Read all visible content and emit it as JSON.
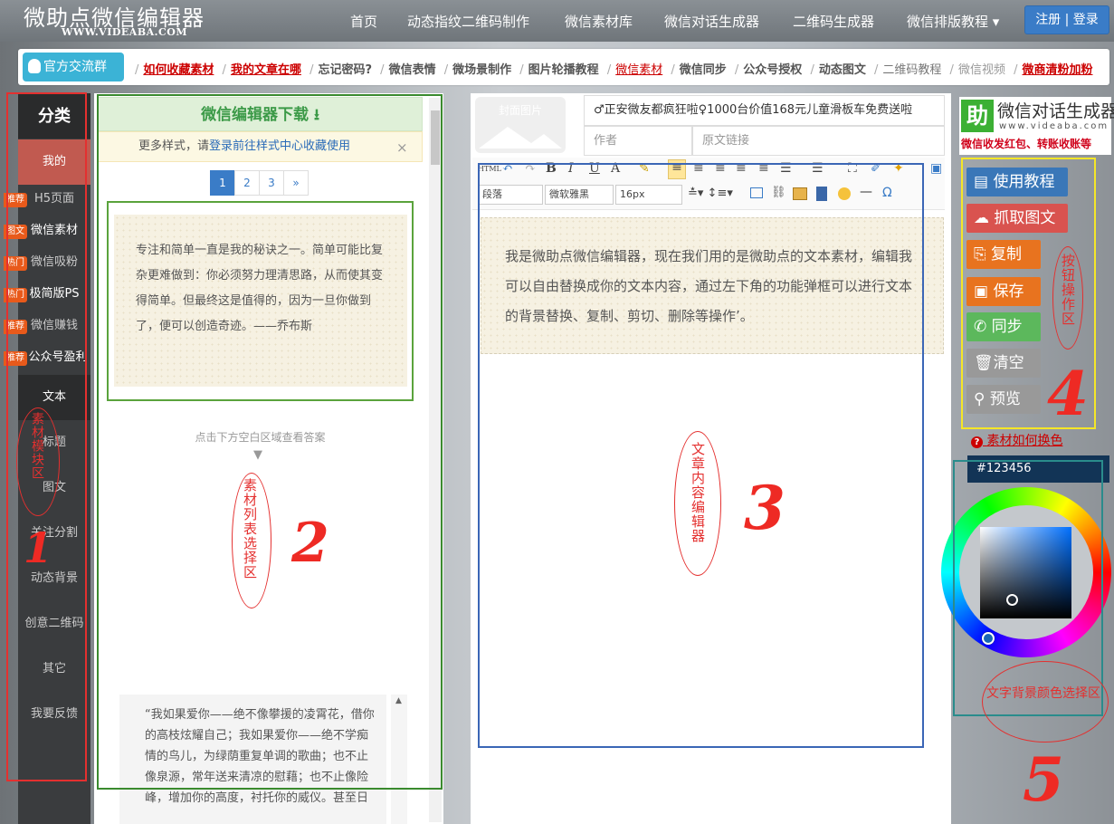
{
  "brand": {
    "title": "微助点微信编辑器",
    "subtitle": "WWW.VIDEABA.COM"
  },
  "nav": {
    "items": [
      "首页",
      "动态指纹二维码制作",
      "微信素材库",
      "微信对话生成器",
      "二维码生成器",
      "微信排版教程 ▾"
    ],
    "login": "注册 | 登录"
  },
  "linkbar": {
    "group": "官方交流群",
    "links": [
      {
        "text": "如何收藏素材",
        "style": "red"
      },
      {
        "text": "我的文章在哪",
        "style": "red"
      },
      {
        "text": "忘记密码?",
        "style": "bold"
      },
      {
        "text": "微信表情",
        "style": "normal"
      },
      {
        "text": "微场景制作",
        "style": "normal"
      },
      {
        "text": "图片轮播教程",
        "style": "normal"
      },
      {
        "text": "微信素材",
        "style": "red"
      },
      {
        "text": "微信同步",
        "style": "normal"
      },
      {
        "text": "公众号授权",
        "style": "normal"
      },
      {
        "text": "动态图文",
        "style": "normal"
      },
      {
        "text": "二维码教程",
        "style": "normal"
      },
      {
        "text": "微信视频",
        "style": "normal"
      },
      {
        "text": "微商清粉加粉",
        "style": "red"
      }
    ]
  },
  "sidebar": {
    "heading": "分类",
    "items": [
      {
        "label": "我的",
        "badge": ""
      },
      {
        "label": "H5页面",
        "badge": "推荐"
      },
      {
        "label": "微信素材",
        "badge": "图文"
      },
      {
        "label": "微信吸粉",
        "badge": "热门"
      },
      {
        "label": "极简版PS",
        "badge": "热门"
      },
      {
        "label": "微信赚钱",
        "badge": "推荐"
      },
      {
        "label": "公众号盈利",
        "badge": "推荐"
      },
      {
        "label": "文本",
        "badge": ""
      },
      {
        "label": "标题",
        "badge": ""
      },
      {
        "label": "图文",
        "badge": ""
      },
      {
        "label": "关注分割",
        "badge": ""
      },
      {
        "label": "动态背景",
        "badge": ""
      },
      {
        "label": "创意二维码",
        "badge": ""
      },
      {
        "label": "其它",
        "badge": ""
      },
      {
        "label": "我要反馈",
        "badge": ""
      }
    ]
  },
  "material_panel": {
    "download_title": "微信编辑器下载",
    "notice_prefix": "更多样式，请",
    "notice_link": "登录前往样式中心收藏使用",
    "close": "×",
    "pages": [
      "1",
      "2",
      "3",
      "»"
    ],
    "card1_text": "专注和简单一直是我的秘诀之一。简单可能比复杂更难做到：你必须努力理清思路，从而使其变得简单。但最终这是值得的，因为一旦你做到了，便可以创造奇迹。——乔布斯",
    "hint": "点击下方空白区域查看答案",
    "hint_arrow": "▼",
    "card2_text": "“我如果爱你——绝不像攀援的凌霄花，借你的高枝炫耀自己；我如果爱你——绝不学痴情的鸟儿，为绿荫重复单调的歌曲；也不止像泉源，常年送来清凉的慰藉；也不止像险峰，增加你的高度，衬托你的威仪。甚至日"
  },
  "editor": {
    "cover": "封面图片",
    "title_value": "♂正安微友都疯狂啦♀1000台价值168元儿童滑板车免费送啦",
    "author_placeholder": "作者",
    "link_placeholder": "原文链接",
    "toolbar_row1": [
      "HTML",
      "↶",
      "↷",
      "B",
      "I",
      "U",
      "A",
      "✎",
      "≡",
      "≡",
      "≡",
      "≡",
      "≡",
      "☰",
      "☰",
      "⛶",
      "✐",
      "✦",
      "▣"
    ],
    "paragraph": "段落",
    "font": "微软雅黑",
    "size": "16px",
    "content": "我是微助点微信编辑器，现在我们用的是微助点的文本素材，编辑我可以自由替换成你的文本内容，通过左下角的功能弹框可以进行文本的背景替换、复制、剪切、删除等操作’。"
  },
  "right": {
    "ad_logo": "助",
    "ad_title": "微信对话生成器",
    "ad_url": "www.videaba.com",
    "ad_sub": "微信收发红包、转账收账等",
    "buttons": [
      {
        "label": "使用教程",
        "icon": "book-icon",
        "color": "#3a77b8"
      },
      {
        "label": "抓取图文",
        "icon": "download-cloud-icon",
        "color": "#d9534f"
      },
      {
        "label": "复制",
        "icon": "copy-icon",
        "color": "#e8731f"
      },
      {
        "label": "保存",
        "icon": "save-icon",
        "color": "#e8731f"
      },
      {
        "label": "同步",
        "icon": "wechat-icon",
        "color": "#5cb85c"
      },
      {
        "label": "清空",
        "icon": "trash-icon",
        "color": "#999999"
      },
      {
        "label": "预览",
        "icon": "search-icon",
        "color": "#999999"
      }
    ],
    "howto": "素材如何换色",
    "hex": "#123456"
  },
  "annotations": {
    "a1": "素材模块区",
    "a2": "素材列表选择区",
    "a3": "文章内容编辑器",
    "a4": "按钮操作区",
    "a5": "文字背景颜色选择区",
    "n1": "1",
    "n2": "2",
    "n3": "3",
    "n4": "4",
    "n5": "5"
  }
}
